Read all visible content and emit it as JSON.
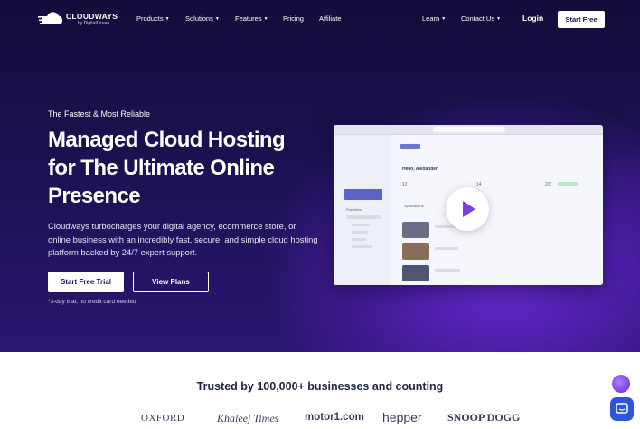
{
  "nav": {
    "logo_name": "CLOUDWAYS",
    "logo_sub": "by DigitalOcean",
    "items": [
      {
        "label": "Products"
      },
      {
        "label": "Solutions"
      },
      {
        "label": "Features"
      },
      {
        "label": "Pricing"
      },
      {
        "label": "Affiliate"
      }
    ],
    "right": {
      "learn": "Learn",
      "contact": "Contact Us",
      "login": "Login",
      "start_free": "Start Free"
    }
  },
  "hero": {
    "kicker": "The Fastest & Most Reliable",
    "headline_lines": [
      "Managed Cloud Hosting",
      "for The Ultimate Online",
      "Presence"
    ],
    "description": "Cloudways turbocharges your digital agency, ecommerce store, or online business with an incredibly fast, secure, and simple cloud hosting platform backed by 24/7 expert support.",
    "primary_cta": "Start Free Trial",
    "secondary_cta": "View Plans",
    "note": "*3-day trial, no credit card needed"
  },
  "mockup": {
    "greeting": "Hello, Alexander",
    "applications_label": "Applications",
    "providers_label": "Providers",
    "stat_1": "12",
    "stat_2": "14",
    "stat_3": "2/3"
  },
  "trusted": {
    "heading": "Trusted by 100,000+ businesses and counting",
    "brands": [
      "OXFORD",
      "Khaleej Times",
      "motor1.com",
      "hepper",
      "SNOOP DOGG"
    ]
  },
  "colors": {
    "hero_bg": "#1b1150",
    "accent_purple": "#7b3fe4",
    "chat_blue": "#2f56d9"
  }
}
